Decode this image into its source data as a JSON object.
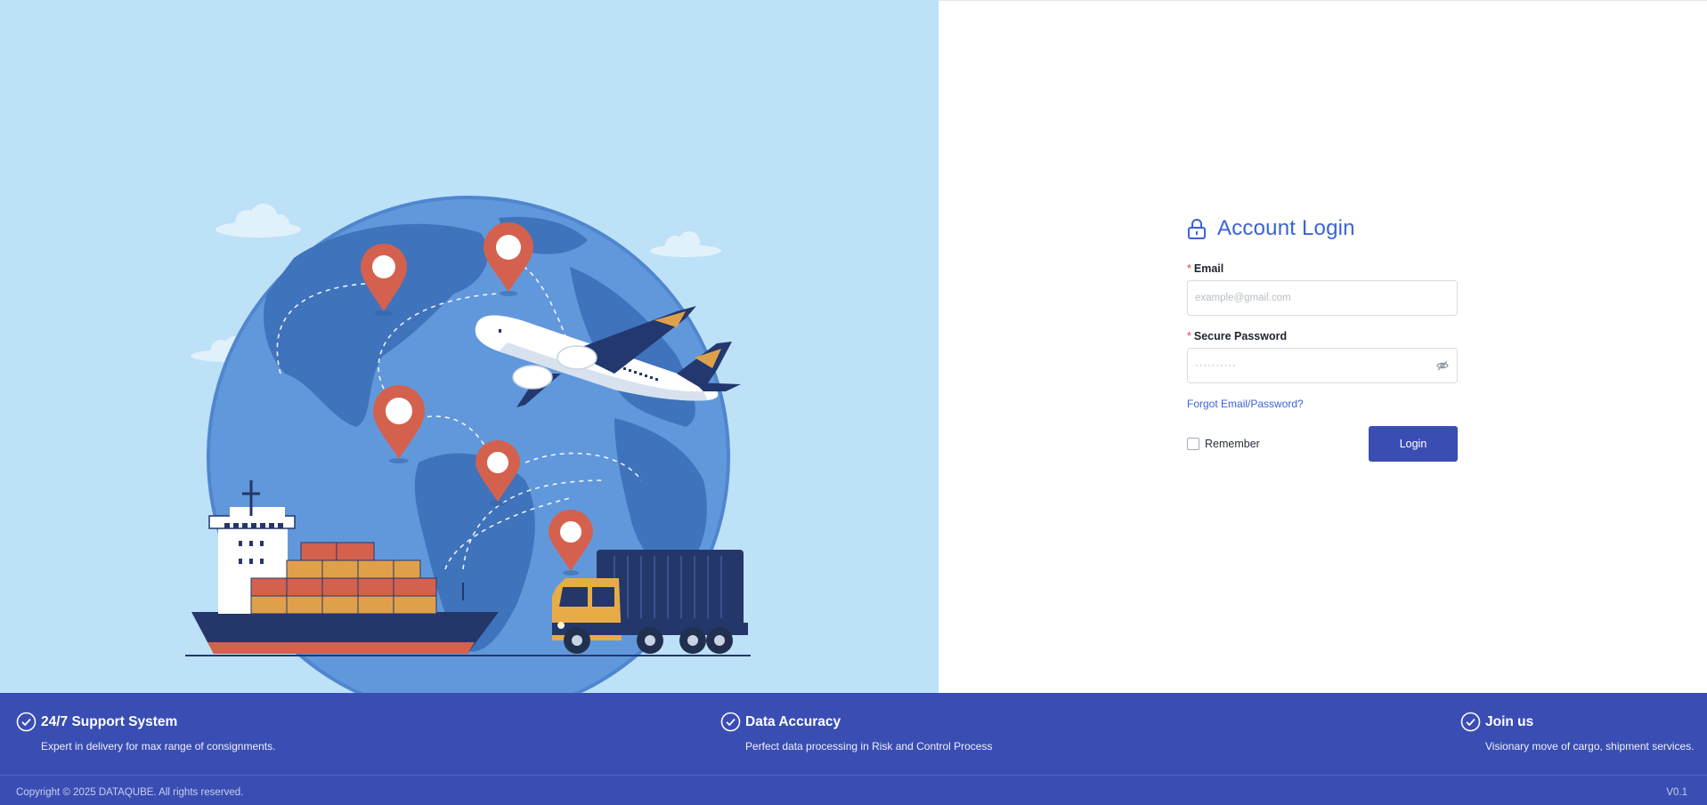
{
  "login": {
    "title": "Account Login",
    "email_label": "Email",
    "email_placeholder": "example@gmail.com",
    "password_label": "Secure Password",
    "password_mask": "··········",
    "required_mark": "*",
    "forgot_link": "Forgot Email/Password?",
    "remember_label": "Remember",
    "login_button": "Login"
  },
  "footer": {
    "features": [
      {
        "title": "24/7 Support System",
        "description": "Expert in delivery for max range of consignments."
      },
      {
        "title": "Data Accuracy",
        "description": "Perfect data processing in Risk and Control Process"
      },
      {
        "title": "Join us",
        "description": "Visionary move of cargo, shipment services."
      }
    ],
    "copyright": "Copyright © 2025 DATAQUBE. All rights reserved.",
    "version": "V0.1"
  },
  "icons": {
    "title": "lock-icon",
    "password_toggle": "eye-off-icon",
    "feature": "check-circle-icon"
  },
  "colors": {
    "accent": "#3a63d8",
    "footer_bg": "#3a4db3",
    "illustration_bg": "#bde1f6",
    "required": "#e0403c"
  }
}
